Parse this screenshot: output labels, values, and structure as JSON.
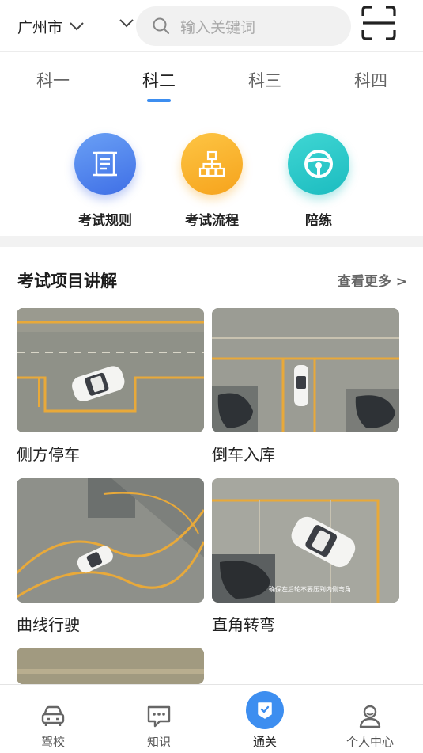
{
  "header": {
    "city": "广州市",
    "search_placeholder": "输入关键词"
  },
  "tabs": [
    {
      "label": "科一",
      "active": false
    },
    {
      "label": "科二",
      "active": true
    },
    {
      "label": "科三",
      "active": false
    },
    {
      "label": "科四",
      "active": false
    }
  ],
  "quick": [
    {
      "label": "考试规则",
      "icon": "scroll-icon",
      "color": "#4f86ee"
    },
    {
      "label": "考试流程",
      "icon": "flowchart-icon",
      "color": "#fbb22a"
    },
    {
      "label": "陪练",
      "icon": "steering-wheel-icon",
      "color": "#23c7c5"
    }
  ],
  "section": {
    "title": "考试项目讲解",
    "more": "查看更多 >"
  },
  "items": [
    {
      "label": "侧方停车"
    },
    {
      "label": "倒车入库"
    },
    {
      "label": "曲线行驶"
    },
    {
      "label": "直角转弯",
      "overlay_text": "确保左后轮不要压到内侧弯角"
    },
    {
      "label": ""
    }
  ],
  "bottom_nav": [
    {
      "label": "驾校",
      "icon": "car-icon",
      "active": false
    },
    {
      "label": "知识",
      "icon": "chat-icon",
      "active": false
    },
    {
      "label": "通关",
      "icon": "check-shield-icon",
      "active": true
    },
    {
      "label": "个人中心",
      "icon": "user-icon",
      "active": false
    }
  ],
  "colors": {
    "accent": "#3d8ef0",
    "lane_yellow": "#e8a93a"
  }
}
